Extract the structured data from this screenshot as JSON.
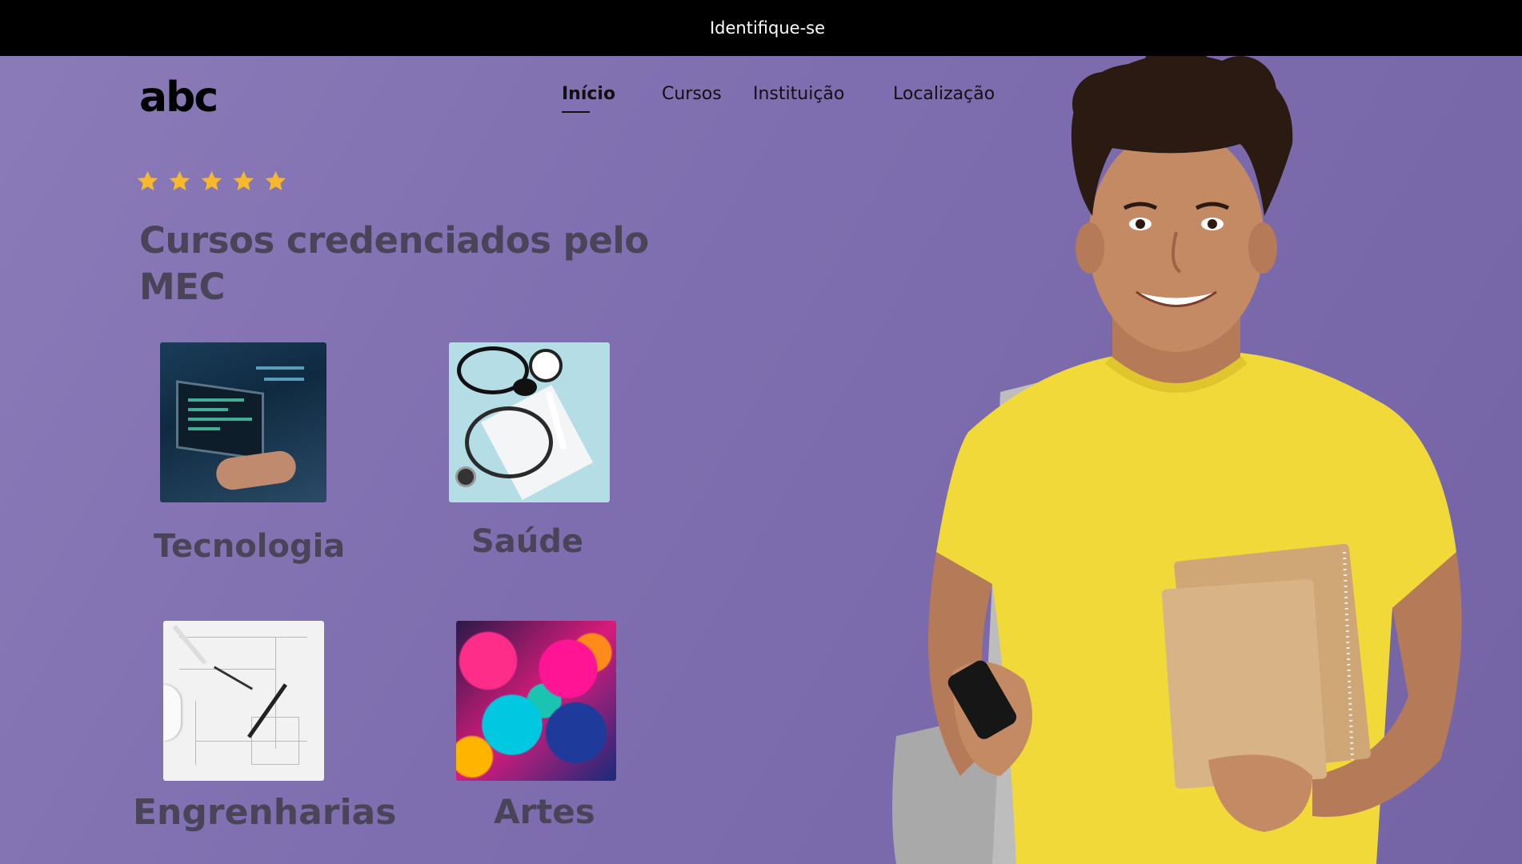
{
  "topbar": {
    "login_label": "Identifique-se"
  },
  "brand": {
    "logo": "abc"
  },
  "nav": {
    "items": [
      {
        "label": "Início",
        "active": true
      },
      {
        "label": "Cursos",
        "active": false
      },
      {
        "label": "Instituição",
        "active": false
      },
      {
        "label": "Localização",
        "active": false
      }
    ]
  },
  "rating": {
    "stars": 5,
    "max": 5,
    "color": "#f5b82e"
  },
  "hero": {
    "headline": "Cursos credenciados pelo MEC"
  },
  "categories": [
    {
      "label": "Tecnologia",
      "image": "laptop-code-image"
    },
    {
      "label": "Saúde",
      "image": "stethoscope-image"
    },
    {
      "label": "Engrenharias",
      "image": "blueprint-image"
    },
    {
      "label": "Artes",
      "image": "fluid-art-image"
    }
  ],
  "colors": {
    "background": "#7f6fb0",
    "topbar": "#000000",
    "headline": "#4a4458",
    "shirt": "#f2d93a"
  }
}
